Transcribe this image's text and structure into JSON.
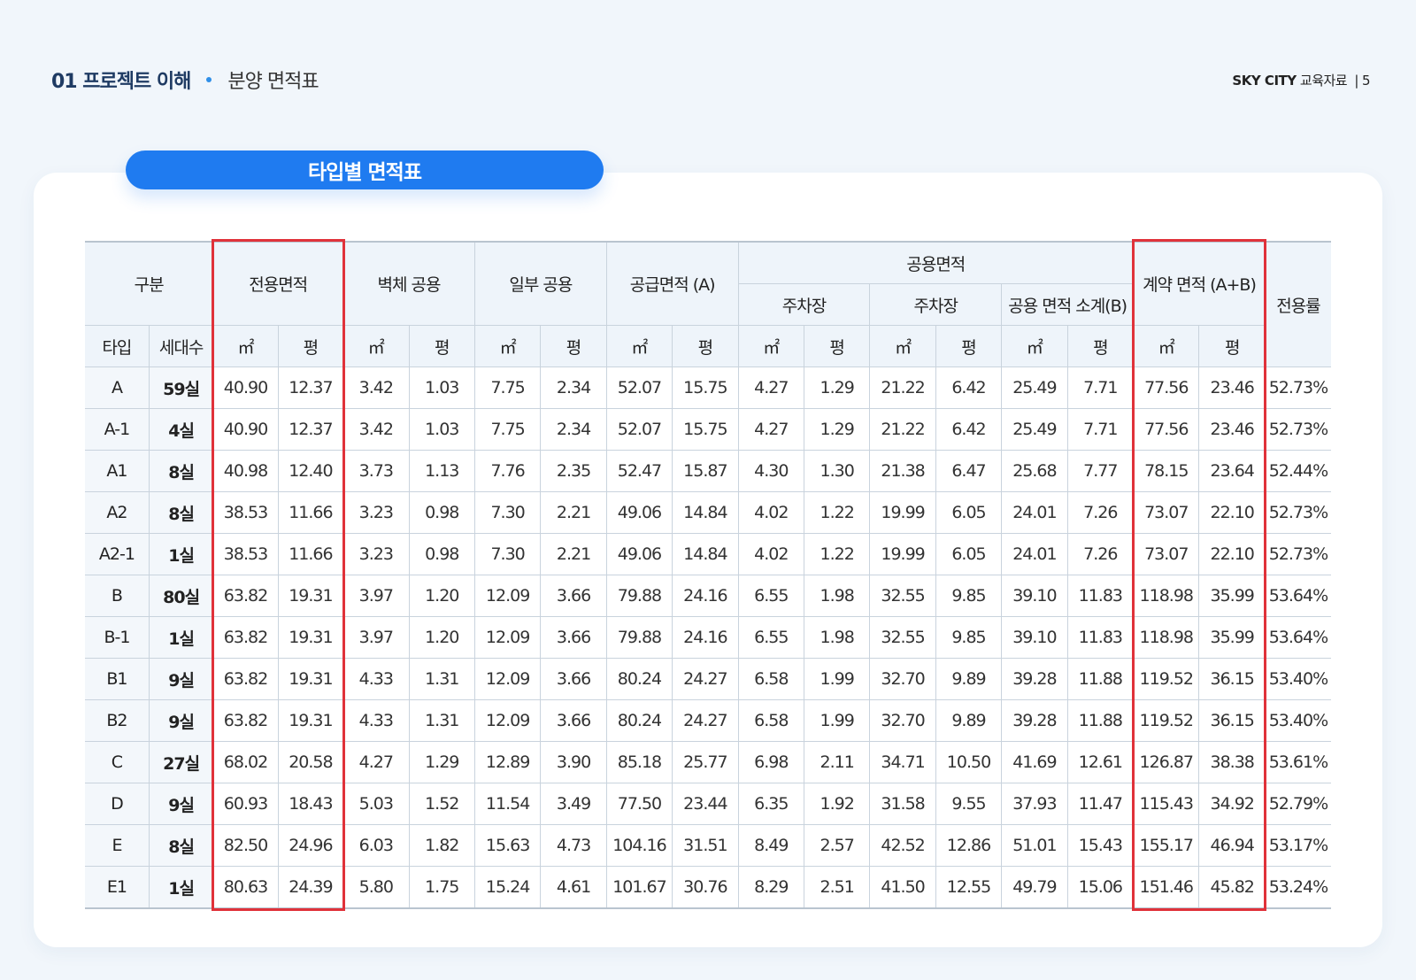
{
  "header": {
    "section_num": "01 프로젝트 이해",
    "section_title": "분양 면적표",
    "brand": "SKY CITY",
    "doc_label": "교육자료",
    "separator": "|",
    "page_number": "5"
  },
  "pill_title": "타입별 면적표",
  "table": {
    "head_row1": {
      "gubun": "구분",
      "exclusive": "전용면적",
      "wall_common": "벽체 공용",
      "partial_common": "일부 공용",
      "supply": "공급면적 (A)",
      "common_area": "공용면적",
      "contract": "계약 면적 (A+B)",
      "ratio": "전용률"
    },
    "head_row2": {
      "parking1": "주차장",
      "parking2": "주차장",
      "common_subtotal": "공용 면적 소계(B)"
    },
    "head_row3": {
      "type": "타입",
      "units": "세대수",
      "sqm": "㎡",
      "pyeong": "평"
    },
    "rows": [
      {
        "type": "A",
        "units": "59실",
        "c": [
          "40.90",
          "12.37",
          "3.42",
          "1.03",
          "7.75",
          "2.34",
          "52.07",
          "15.75",
          "4.27",
          "1.29",
          "21.22",
          "6.42",
          "25.49",
          "7.71",
          "77.56",
          "23.46",
          "52.73%"
        ]
      },
      {
        "type": "A-1",
        "units": "4실",
        "c": [
          "40.90",
          "12.37",
          "3.42",
          "1.03",
          "7.75",
          "2.34",
          "52.07",
          "15.75",
          "4.27",
          "1.29",
          "21.22",
          "6.42",
          "25.49",
          "7.71",
          "77.56",
          "23.46",
          "52.73%"
        ]
      },
      {
        "type": "A1",
        "units": "8실",
        "c": [
          "40.98",
          "12.40",
          "3.73",
          "1.13",
          "7.76",
          "2.35",
          "52.47",
          "15.87",
          "4.30",
          "1.30",
          "21.38",
          "6.47",
          "25.68",
          "7.77",
          "78.15",
          "23.64",
          "52.44%"
        ]
      },
      {
        "type": "A2",
        "units": "8실",
        "c": [
          "38.53",
          "11.66",
          "3.23",
          "0.98",
          "7.30",
          "2.21",
          "49.06",
          "14.84",
          "4.02",
          "1.22",
          "19.99",
          "6.05",
          "24.01",
          "7.26",
          "73.07",
          "22.10",
          "52.73%"
        ]
      },
      {
        "type": "A2-1",
        "units": "1실",
        "c": [
          "38.53",
          "11.66",
          "3.23",
          "0.98",
          "7.30",
          "2.21",
          "49.06",
          "14.84",
          "4.02",
          "1.22",
          "19.99",
          "6.05",
          "24.01",
          "7.26",
          "73.07",
          "22.10",
          "52.73%"
        ]
      },
      {
        "type": "B",
        "units": "80실",
        "c": [
          "63.82",
          "19.31",
          "3.97",
          "1.20",
          "12.09",
          "3.66",
          "79.88",
          "24.16",
          "6.55",
          "1.98",
          "32.55",
          "9.85",
          "39.10",
          "11.83",
          "118.98",
          "35.99",
          "53.64%"
        ]
      },
      {
        "type": "B-1",
        "units": "1실",
        "c": [
          "63.82",
          "19.31",
          "3.97",
          "1.20",
          "12.09",
          "3.66",
          "79.88",
          "24.16",
          "6.55",
          "1.98",
          "32.55",
          "9.85",
          "39.10",
          "11.83",
          "118.98",
          "35.99",
          "53.64%"
        ]
      },
      {
        "type": "B1",
        "units": "9실",
        "c": [
          "63.82",
          "19.31",
          "4.33",
          "1.31",
          "12.09",
          "3.66",
          "80.24",
          "24.27",
          "6.58",
          "1.99",
          "32.70",
          "9.89",
          "39.28",
          "11.88",
          "119.52",
          "36.15",
          "53.40%"
        ]
      },
      {
        "type": "B2",
        "units": "9실",
        "c": [
          "63.82",
          "19.31",
          "4.33",
          "1.31",
          "12.09",
          "3.66",
          "80.24",
          "24.27",
          "6.58",
          "1.99",
          "32.70",
          "9.89",
          "39.28",
          "11.88",
          "119.52",
          "36.15",
          "53.40%"
        ]
      },
      {
        "type": "C",
        "units": "27실",
        "c": [
          "68.02",
          "20.58",
          "4.27",
          "1.29",
          "12.89",
          "3.90",
          "85.18",
          "25.77",
          "6.98",
          "2.11",
          "34.71",
          "10.50",
          "41.69",
          "12.61",
          "126.87",
          "38.38",
          "53.61%"
        ]
      },
      {
        "type": "D",
        "units": "9실",
        "c": [
          "60.93",
          "18.43",
          "5.03",
          "1.52",
          "11.54",
          "3.49",
          "77.50",
          "23.44",
          "6.35",
          "1.92",
          "31.58",
          "9.55",
          "37.93",
          "11.47",
          "115.43",
          "34.92",
          "52.79%"
        ]
      },
      {
        "type": "E",
        "units": "8실",
        "c": [
          "82.50",
          "24.96",
          "6.03",
          "1.82",
          "15.63",
          "4.73",
          "104.16",
          "31.51",
          "8.49",
          "2.57",
          "42.52",
          "12.86",
          "51.01",
          "15.43",
          "155.17",
          "46.94",
          "53.17%"
        ]
      },
      {
        "type": "E1",
        "units": "1실",
        "c": [
          "80.63",
          "24.39",
          "5.80",
          "1.75",
          "15.24",
          "4.61",
          "101.67",
          "30.76",
          "8.29",
          "2.51",
          "41.50",
          "12.55",
          "49.79",
          "15.06",
          "151.46",
          "45.82",
          "53.24%"
        ]
      }
    ]
  },
  "colors": {
    "accent": "#1f7bf0",
    "highlight": "#e0323a",
    "heading": "#1f3b63",
    "page_bg": "#f1f6fb"
  }
}
